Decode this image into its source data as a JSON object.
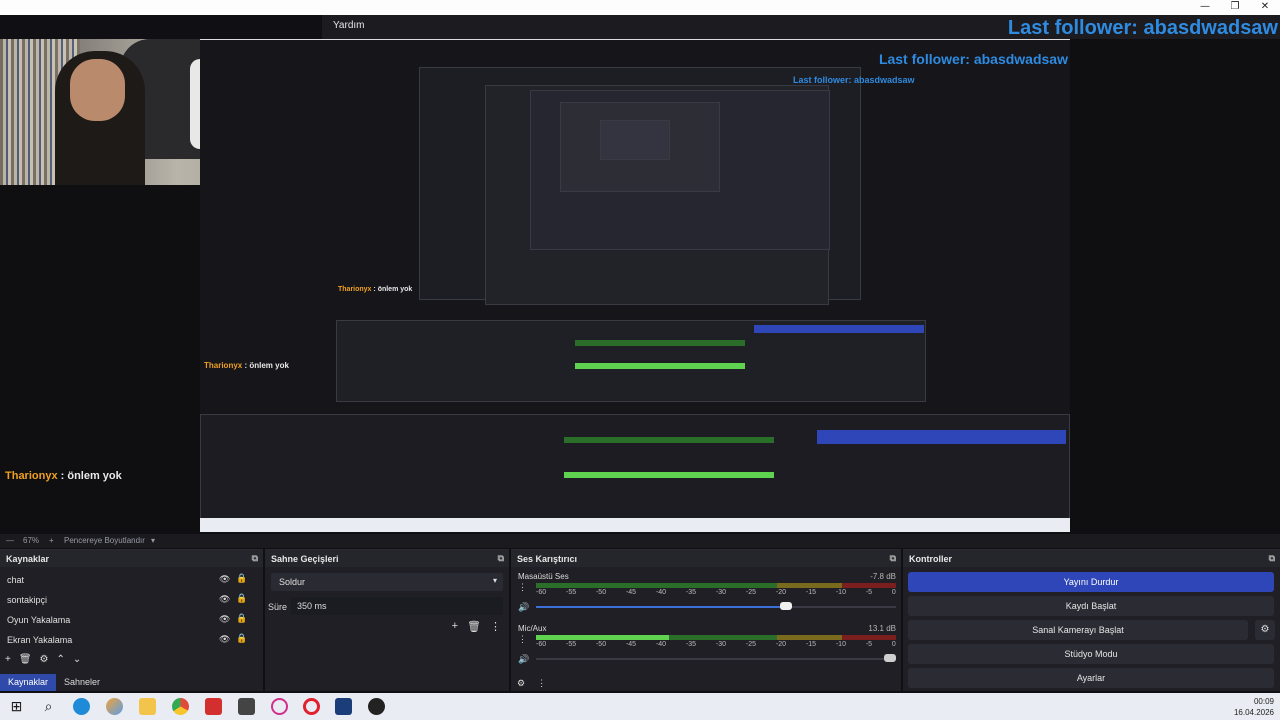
{
  "window": {
    "minimize": "—",
    "maximize": "❐",
    "close": "✕"
  },
  "menu": {
    "help": "Yardım"
  },
  "overlay": {
    "follower_text": "Last follower: abasdwadsaw",
    "chat_nick": "Tharionyx",
    "chat_sep": " : ",
    "chat_msg": "önlem yok"
  },
  "zoom": {
    "level": "67%",
    "plus": "+",
    "fit": "Pencereye Boyutlandır",
    "caret": "▾"
  },
  "sources": {
    "title": "Kaynaklar",
    "items": [
      {
        "label": "chat"
      },
      {
        "label": "sontakipçi"
      },
      {
        "label": "Oyun Yakalama"
      },
      {
        "label": "Ekran Yakalama"
      }
    ],
    "tools": [
      "+",
      "🗑",
      "⚙",
      "⌃",
      "⌄"
    ],
    "tabs": [
      "Kaynaklar",
      "Sahneler"
    ]
  },
  "transitions": {
    "title": "Sahne Geçişleri",
    "selected": "Soldur",
    "duration_label": "Süre",
    "duration_value": "350 ms",
    "tools": [
      "+",
      "🗑",
      "⋮"
    ]
  },
  "mixer": {
    "title": "Ses Karıştırıcı",
    "scale": [
      "-60",
      "-55",
      "-50",
      "-45",
      "-40",
      "-35",
      "-30",
      "-25",
      "-20",
      "-15",
      "-10",
      "-5",
      "0"
    ],
    "channels": [
      {
        "name": "Masaüstü Ses",
        "db": "-7.8 dB",
        "level": 0.0,
        "volume": 0.7
      },
      {
        "name": "Mic/Aux",
        "db": "13.1 dB",
        "level": 0.37,
        "volume": 1.0
      }
    ]
  },
  "controls": {
    "title": "Kontroller",
    "stop_stream": "Yayını Durdur",
    "start_record": "Kaydı Başlat",
    "virtual_cam": "Sanal Kamerayı Başlat",
    "studio_mode": "Stüdyo Modu",
    "settings": "Ayarlar"
  },
  "taskbar": {
    "time": "00:09",
    "date": "16.04.2026"
  },
  "colors": {
    "accent": "#2e46b8",
    "follower": "#2f8be0",
    "nick": "#f0a020"
  }
}
